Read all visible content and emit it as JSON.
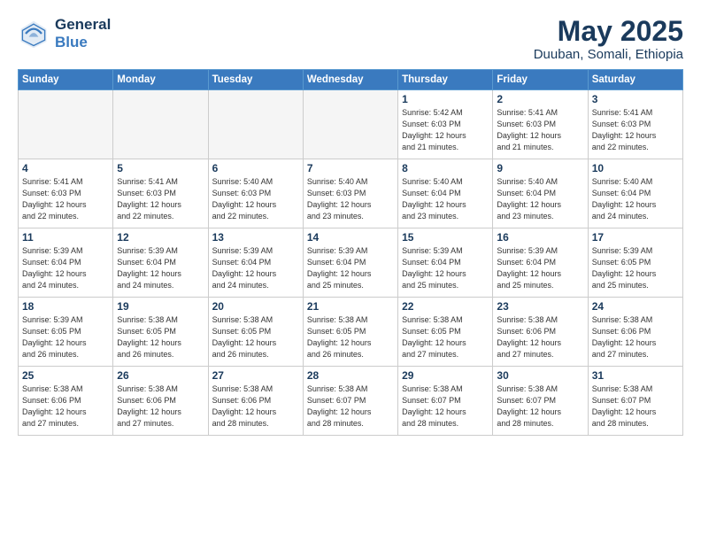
{
  "header": {
    "logo_line1": "General",
    "logo_line2": "Blue",
    "title": "May 2025",
    "subtitle": "Duuban, Somali, Ethiopia"
  },
  "days_of_week": [
    "Sunday",
    "Monday",
    "Tuesday",
    "Wednesday",
    "Thursday",
    "Friday",
    "Saturday"
  ],
  "weeks": [
    [
      {
        "day": "",
        "info": ""
      },
      {
        "day": "",
        "info": ""
      },
      {
        "day": "",
        "info": ""
      },
      {
        "day": "",
        "info": ""
      },
      {
        "day": "1",
        "info": "Sunrise: 5:42 AM\nSunset: 6:03 PM\nDaylight: 12 hours\nand 21 minutes."
      },
      {
        "day": "2",
        "info": "Sunrise: 5:41 AM\nSunset: 6:03 PM\nDaylight: 12 hours\nand 21 minutes."
      },
      {
        "day": "3",
        "info": "Sunrise: 5:41 AM\nSunset: 6:03 PM\nDaylight: 12 hours\nand 22 minutes."
      }
    ],
    [
      {
        "day": "4",
        "info": "Sunrise: 5:41 AM\nSunset: 6:03 PM\nDaylight: 12 hours\nand 22 minutes."
      },
      {
        "day": "5",
        "info": "Sunrise: 5:41 AM\nSunset: 6:03 PM\nDaylight: 12 hours\nand 22 minutes."
      },
      {
        "day": "6",
        "info": "Sunrise: 5:40 AM\nSunset: 6:03 PM\nDaylight: 12 hours\nand 22 minutes."
      },
      {
        "day": "7",
        "info": "Sunrise: 5:40 AM\nSunset: 6:03 PM\nDaylight: 12 hours\nand 23 minutes."
      },
      {
        "day": "8",
        "info": "Sunrise: 5:40 AM\nSunset: 6:04 PM\nDaylight: 12 hours\nand 23 minutes."
      },
      {
        "day": "9",
        "info": "Sunrise: 5:40 AM\nSunset: 6:04 PM\nDaylight: 12 hours\nand 23 minutes."
      },
      {
        "day": "10",
        "info": "Sunrise: 5:40 AM\nSunset: 6:04 PM\nDaylight: 12 hours\nand 24 minutes."
      }
    ],
    [
      {
        "day": "11",
        "info": "Sunrise: 5:39 AM\nSunset: 6:04 PM\nDaylight: 12 hours\nand 24 minutes."
      },
      {
        "day": "12",
        "info": "Sunrise: 5:39 AM\nSunset: 6:04 PM\nDaylight: 12 hours\nand 24 minutes."
      },
      {
        "day": "13",
        "info": "Sunrise: 5:39 AM\nSunset: 6:04 PM\nDaylight: 12 hours\nand 24 minutes."
      },
      {
        "day": "14",
        "info": "Sunrise: 5:39 AM\nSunset: 6:04 PM\nDaylight: 12 hours\nand 25 minutes."
      },
      {
        "day": "15",
        "info": "Sunrise: 5:39 AM\nSunset: 6:04 PM\nDaylight: 12 hours\nand 25 minutes."
      },
      {
        "day": "16",
        "info": "Sunrise: 5:39 AM\nSunset: 6:04 PM\nDaylight: 12 hours\nand 25 minutes."
      },
      {
        "day": "17",
        "info": "Sunrise: 5:39 AM\nSunset: 6:05 PM\nDaylight: 12 hours\nand 25 minutes."
      }
    ],
    [
      {
        "day": "18",
        "info": "Sunrise: 5:39 AM\nSunset: 6:05 PM\nDaylight: 12 hours\nand 26 minutes."
      },
      {
        "day": "19",
        "info": "Sunrise: 5:38 AM\nSunset: 6:05 PM\nDaylight: 12 hours\nand 26 minutes."
      },
      {
        "day": "20",
        "info": "Sunrise: 5:38 AM\nSunset: 6:05 PM\nDaylight: 12 hours\nand 26 minutes."
      },
      {
        "day": "21",
        "info": "Sunrise: 5:38 AM\nSunset: 6:05 PM\nDaylight: 12 hours\nand 26 minutes."
      },
      {
        "day": "22",
        "info": "Sunrise: 5:38 AM\nSunset: 6:05 PM\nDaylight: 12 hours\nand 27 minutes."
      },
      {
        "day": "23",
        "info": "Sunrise: 5:38 AM\nSunset: 6:06 PM\nDaylight: 12 hours\nand 27 minutes."
      },
      {
        "day": "24",
        "info": "Sunrise: 5:38 AM\nSunset: 6:06 PM\nDaylight: 12 hours\nand 27 minutes."
      }
    ],
    [
      {
        "day": "25",
        "info": "Sunrise: 5:38 AM\nSunset: 6:06 PM\nDaylight: 12 hours\nand 27 minutes."
      },
      {
        "day": "26",
        "info": "Sunrise: 5:38 AM\nSunset: 6:06 PM\nDaylight: 12 hours\nand 27 minutes."
      },
      {
        "day": "27",
        "info": "Sunrise: 5:38 AM\nSunset: 6:06 PM\nDaylight: 12 hours\nand 28 minutes."
      },
      {
        "day": "28",
        "info": "Sunrise: 5:38 AM\nSunset: 6:07 PM\nDaylight: 12 hours\nand 28 minutes."
      },
      {
        "day": "29",
        "info": "Sunrise: 5:38 AM\nSunset: 6:07 PM\nDaylight: 12 hours\nand 28 minutes."
      },
      {
        "day": "30",
        "info": "Sunrise: 5:38 AM\nSunset: 6:07 PM\nDaylight: 12 hours\nand 28 minutes."
      },
      {
        "day": "31",
        "info": "Sunrise: 5:38 AM\nSunset: 6:07 PM\nDaylight: 12 hours\nand 28 minutes."
      }
    ]
  ],
  "colors": {
    "header_bg": "#3a7abf",
    "title_color": "#1a3a5c"
  }
}
